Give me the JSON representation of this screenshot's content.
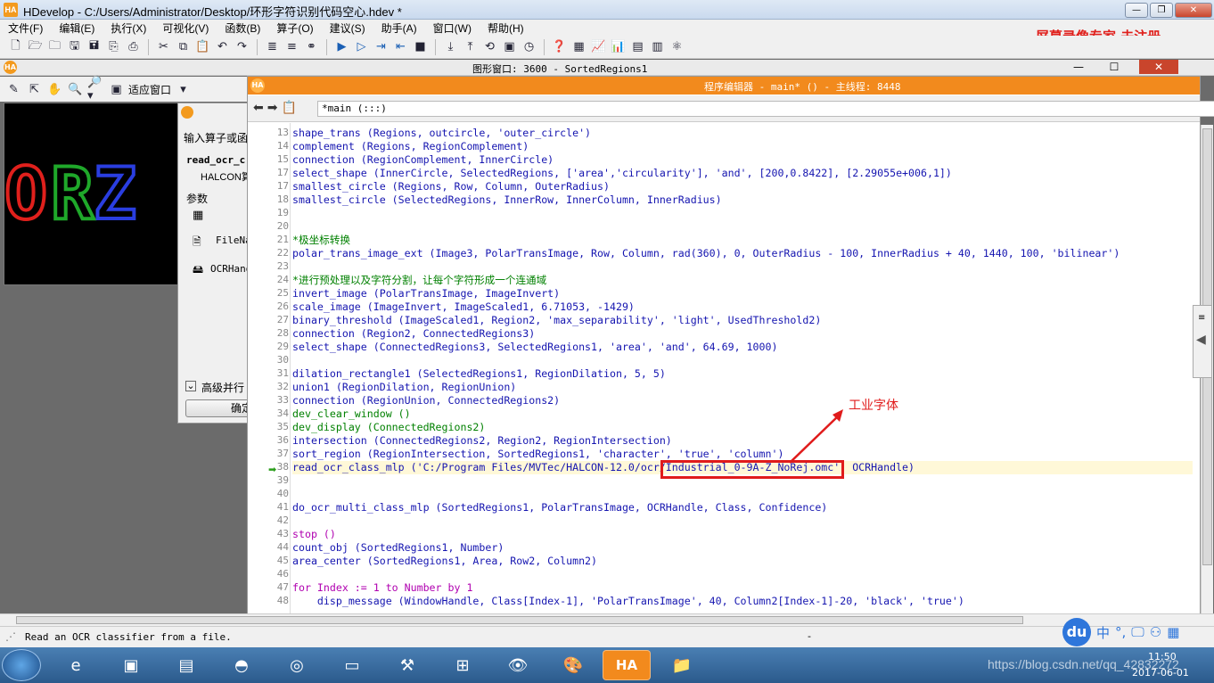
{
  "window": {
    "title": "HDevelop - C:/Users/Administrator/Desktop/环形字符识别代码空心.hdev *",
    "app_logo": "HA",
    "controls": [
      "—",
      "❐",
      "✕"
    ]
  },
  "menu": [
    "文件(F)",
    "编辑(E)",
    "执行(X)",
    "可视化(V)",
    "函数(B)",
    "算子(O)",
    "建议(S)",
    "助手(A)",
    "窗口(W)",
    "帮助(H)"
  ],
  "watermark": "屏幕录像专家 未注册",
  "graphics_window": {
    "title": "图形窗口: 3600 - SortedRegions1",
    "fit_label": "适应窗口",
    "ocr_letters": [
      "O",
      "R",
      "Z"
    ],
    "letter_colors": [
      "#e0201c",
      "#1fa82a",
      "#2a3ee0"
    ]
  },
  "operator_dialog": {
    "prompt": "输入算子或函",
    "operator": "read_ocr_c",
    "operator_sub": "HALCON算",
    "params_label": "参数",
    "param1": "FileNa",
    "param2": "OCRHand",
    "advanced": "高级并行",
    "ok": "确定"
  },
  "editor": {
    "title": "程序编辑器 - main* () - 主线程: 8448",
    "tab": "*main (:::)",
    "lines": [
      {
        "n": "13",
        "t": "shape_trans (Regions, outcircle, 'outer_circle')",
        "c": "op"
      },
      {
        "n": "14",
        "t": "complement (Regions, RegionComplement)",
        "c": "op"
      },
      {
        "n": "15",
        "t": "connection (RegionComplement, InnerCircle)",
        "c": "op"
      },
      {
        "n": "17",
        "t": "select_shape (InnerCircle, SelectedRegions, ['area','circularity'], 'and', [200,0.8422], [2.29055e+006,1])",
        "c": "op"
      },
      {
        "n": "17",
        "t": "smallest_circle (Regions, Row, Column, OuterRadius)",
        "c": "op"
      },
      {
        "n": "18",
        "t": "smallest_circle (SelectedRegions, InnerRow, InnerColumn, InnerRadius)",
        "c": "op"
      },
      {
        "n": "19",
        "t": "",
        "c": "op"
      },
      {
        "n": "20",
        "t": "",
        "c": "op"
      },
      {
        "n": "21",
        "t": "*极坐标转换",
        "c": "comment"
      },
      {
        "n": "22",
        "t": "polar_trans_image_ext (Image3, PolarTransImage, Row, Column, rad(360), 0, OuterRadius - 100, InnerRadius + 40, 1440, 100, 'bilinear')",
        "c": "op"
      },
      {
        "n": "23",
        "t": "",
        "c": "op"
      },
      {
        "n": "24",
        "t": "*进行预处理以及字符分割，让每个字符形成一个连通域",
        "c": "comment"
      },
      {
        "n": "25",
        "t": "invert_image (PolarTransImage, ImageInvert)",
        "c": "op"
      },
      {
        "n": "26",
        "t": "scale_image (ImageInvert, ImageScaled1, 6.71053, -1429)",
        "c": "op"
      },
      {
        "n": "27",
        "t": "binary_threshold (ImageScaled1, Region2, 'max_separability', 'light', UsedThreshold2)",
        "c": "op"
      },
      {
        "n": "28",
        "t": "connection (Region2, ConnectedRegions3)",
        "c": "op"
      },
      {
        "n": "29",
        "t": "select_shape (ConnectedRegions3, SelectedRegions1, 'area', 'and', 64.69, 1000)",
        "c": "op"
      },
      {
        "n": "30",
        "t": "",
        "c": "op"
      },
      {
        "n": "31",
        "t": "dilation_rectangle1 (SelectedRegions1, RegionDilation, 5, 5)",
        "c": "op"
      },
      {
        "n": "32",
        "t": "union1 (RegionDilation, RegionUnion)",
        "c": "op"
      },
      {
        "n": "33",
        "t": "connection (RegionUnion, ConnectedRegions2)",
        "c": "op"
      },
      {
        "n": "34",
        "t": "dev_clear_window ()",
        "c": "comment"
      },
      {
        "n": "35",
        "t": "dev_display (ConnectedRegions2)",
        "c": "comment"
      },
      {
        "n": "36",
        "t": "intersection (ConnectedRegions2, Region2, RegionIntersection)",
        "c": "op"
      },
      {
        "n": "37",
        "t": "sort_region (RegionIntersection, SortedRegions1, 'character', 'true', 'column')",
        "c": "op"
      },
      {
        "n": "38",
        "t": "read_ocr_class_mlp ('C:/Program Files/MVTec/HALCON-12.0/ocr/Industrial_0-9A-Z_NoRej.omc', OCRHandle)",
        "c": "op"
      },
      {
        "n": "39",
        "t": "",
        "c": "op"
      },
      {
        "n": "40",
        "t": "",
        "c": "op"
      },
      {
        "n": "41",
        "t": "do_ocr_multi_class_mlp (SortedRegions1, PolarTransImage, OCRHandle, Class, Confidence)",
        "c": "op"
      },
      {
        "n": "42",
        "t": "",
        "c": "op"
      },
      {
        "n": "43",
        "t": "stop ()",
        "c": "kw"
      },
      {
        "n": "44",
        "t": "count_obj (SortedRegions1, Number)",
        "c": "op"
      },
      {
        "n": "45",
        "t": "area_center (SortedRegions1, Area, Row2, Column2)",
        "c": "op"
      },
      {
        "n": "46",
        "t": "",
        "c": "op"
      },
      {
        "n": "47",
        "t": "for Index := 1 to Number by 1",
        "c": "kw"
      },
      {
        "n": "48",
        "t": "    disp_message (WindowHandle, Class[Index-1], 'PolarTransImage', 40, Column2[Index-1]-20, 'black', 'true')",
        "c": "op"
      }
    ]
  },
  "annotation": "工业字体",
  "status": {
    "text": "Read an OCR classifier from a file.",
    "dash": "-"
  },
  "ime": {
    "logo": "du",
    "items": [
      "中",
      "°,",
      "🖵",
      "⚇",
      "▦"
    ]
  },
  "taskbar": {
    "url_watermark": "https://blog.csdn.net/qq_42832272",
    "time": "11:50",
    "date": "2017-06-01",
    "apps": [
      "e",
      "▣",
      "▤",
      "◓",
      "◎",
      "▭",
      "⚒",
      "⊞",
      "👁",
      "🎨",
      "HA",
      "📁"
    ]
  }
}
